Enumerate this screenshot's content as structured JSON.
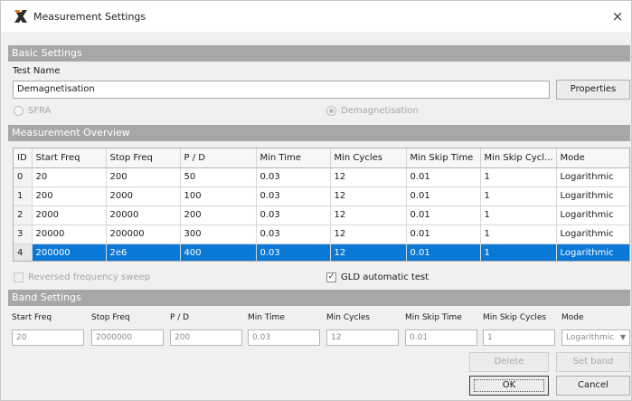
{
  "window": {
    "title": "Measurement Settings",
    "close_glyph": "×"
  },
  "sections": {
    "basic": "Basic Settings",
    "overview": "Measurement Overview",
    "band": "Band Settings"
  },
  "basic": {
    "test_name_label": "Test Name",
    "test_name_value": "Demagnetisation",
    "properties_label": "Properties",
    "radio_sfra": "SFRA",
    "radio_demag": "Demagnetisation"
  },
  "table": {
    "headers": [
      "ID",
      "Start Freq",
      "Stop Freq",
      "P / D",
      "Min Time",
      "Min Cycles",
      "Min Skip Time",
      "Min Skip Cycl...",
      "Mode"
    ],
    "rows": [
      [
        "0",
        "20",
        "200",
        "50",
        "0.03",
        "12",
        "0.01",
        "1",
        "Logarithmic"
      ],
      [
        "1",
        "200",
        "2000",
        "100",
        "0.03",
        "12",
        "0.01",
        "1",
        "Logarithmic"
      ],
      [
        "2",
        "2000",
        "20000",
        "200",
        "0.03",
        "12",
        "0.01",
        "1",
        "Logarithmic"
      ],
      [
        "3",
        "20000",
        "200000",
        "300",
        "0.03",
        "12",
        "0.01",
        "1",
        "Logarithmic"
      ],
      [
        "4",
        "200000",
        "2e6",
        "400",
        "0.03",
        "12",
        "0.01",
        "1",
        "Logarithmic"
      ]
    ],
    "selected_row": 4
  },
  "options": {
    "reversed_sweep": "Reversed frequency sweep",
    "gld_test": "GLD automatic test",
    "check_glyph": "✓"
  },
  "band": {
    "start_freq": {
      "label": "Start Freq",
      "value": "20"
    },
    "stop_freq": {
      "label": "Stop Freq",
      "value": "2000000"
    },
    "pd": {
      "label": "P / D",
      "value": "200"
    },
    "min_time": {
      "label": "Min Time",
      "value": "0.03"
    },
    "min_cycles": {
      "label": "Min Cycles",
      "value": "12"
    },
    "min_skip_time": {
      "label": "Min Skip Time",
      "value": "0.01"
    },
    "min_skip_cycles": {
      "label": "Min Skip Cycles",
      "value": "1"
    },
    "mode": {
      "label": "Mode",
      "value": "Logarithmic"
    }
  },
  "buttons": {
    "delete": "Delete",
    "set_band": "Set band",
    "ok": "OK",
    "cancel": "Cancel"
  },
  "colors": {
    "selection": "#0a78d7",
    "section_header": "#a7a7a7"
  },
  "icons": {
    "app": "app-x-logo-icon",
    "close": "close-icon",
    "combo_arrow": "chevron-down-icon"
  }
}
